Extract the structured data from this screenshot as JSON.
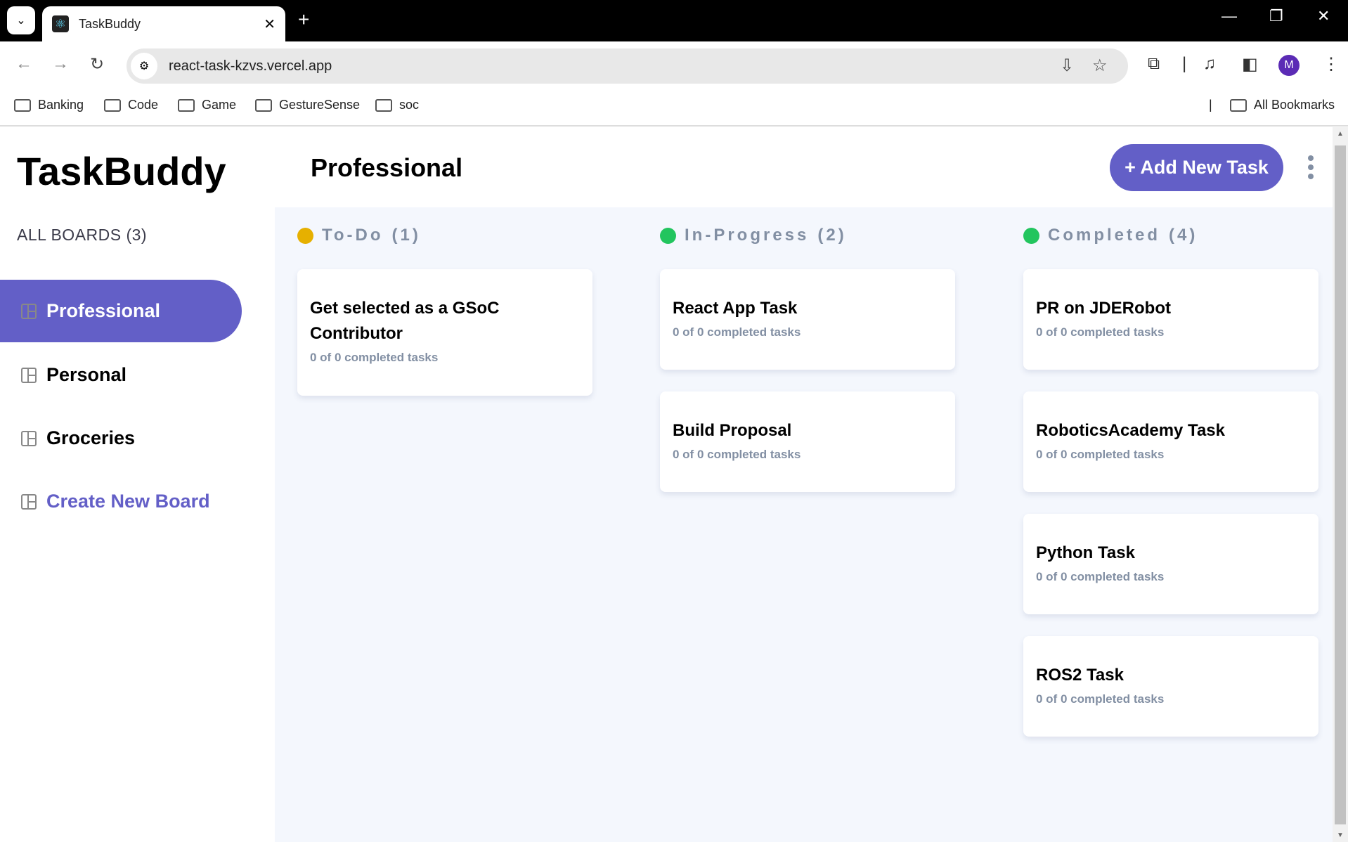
{
  "browser": {
    "tab_title": "TaskBuddy",
    "url": "react-task-kzvs.vercel.app",
    "profile_initial": "M",
    "bookmarks": [
      "Banking",
      "Code",
      "Game",
      "GestureSense",
      "soc"
    ],
    "all_bookmarks": "All Bookmarks"
  },
  "sidebar": {
    "logo": "TaskBuddy",
    "all_boards": "ALL BOARDS (3)",
    "boards": [
      {
        "label": "Professional"
      },
      {
        "label": "Personal"
      },
      {
        "label": "Groceries"
      }
    ],
    "create": "Create New Board"
  },
  "header": {
    "title": "Professional",
    "add_button": "+ Add New Task"
  },
  "columns": [
    {
      "label": "To-Do",
      "count": "(1)",
      "color": "#e6b000",
      "cards": [
        {
          "title": "Get selected as a GSoC Contributor",
          "sub": "0 of 0 completed tasks"
        }
      ]
    },
    {
      "label": "In-Progress",
      "count": "(2)",
      "color": "#22c55e",
      "cards": [
        {
          "title": "React App Task",
          "sub": "0 of 0 completed tasks"
        },
        {
          "title": "Build Proposal",
          "sub": "0 of 0 completed tasks"
        }
      ]
    },
    {
      "label": "Completed",
      "count": "(4)",
      "color": "#22c55e",
      "cards": [
        {
          "title": "PR on JDERobot",
          "sub": "0 of 0 completed tasks"
        },
        {
          "title": "RoboticsAcademy Task",
          "sub": "0 of 0 completed tasks"
        },
        {
          "title": "Python Task",
          "sub": "0 of 0 completed tasks"
        },
        {
          "title": "ROS2 Task",
          "sub": "0 of 0 completed tasks"
        }
      ]
    }
  ]
}
